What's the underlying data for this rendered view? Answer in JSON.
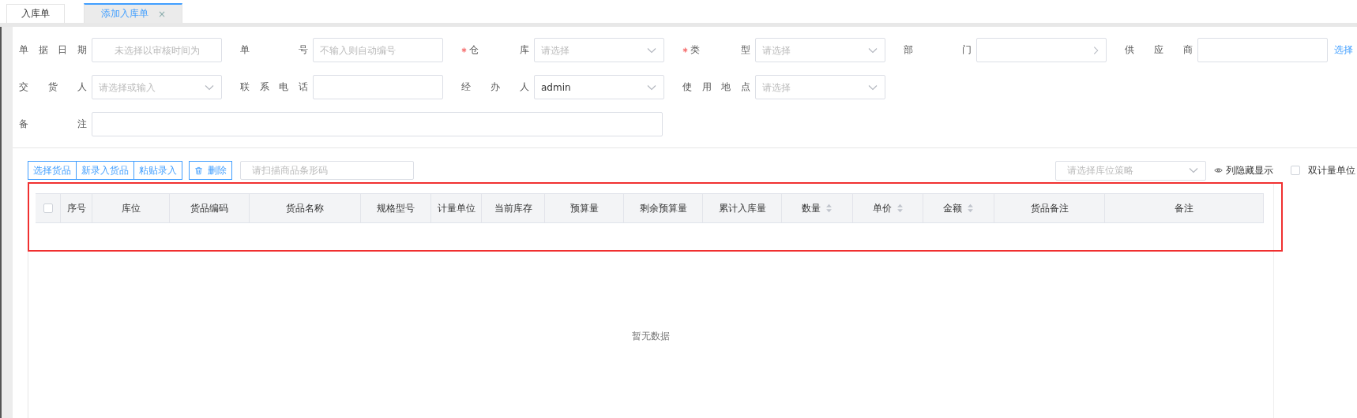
{
  "tabs": [
    {
      "label": "入库单",
      "selected": false,
      "closable": false
    },
    {
      "label": "添加入库单",
      "selected": true,
      "closable": true,
      "close": "×"
    }
  ],
  "form": {
    "rows": [
      [
        {
          "label": "单据日期",
          "kind": "date",
          "required": false,
          "placeholder": "未选择以审核时间为"
        },
        {
          "label": "单号",
          "kind": "input",
          "required": false,
          "placeholder": "不输入则自动编号"
        },
        {
          "label": "仓库",
          "kind": "select",
          "required": true,
          "placeholder": "请选择"
        },
        {
          "label": "类型",
          "kind": "select",
          "required": true,
          "placeholder": "请选择"
        },
        {
          "label": "部门",
          "kind": "cascader",
          "required": false
        },
        {
          "label": "供应商",
          "kind": "picker",
          "required": false,
          "link": "选择"
        }
      ],
      [
        {
          "label": "交货人",
          "kind": "select",
          "required": false,
          "placeholder": "请选择或输入"
        },
        {
          "label": "联系电话",
          "kind": "input",
          "required": false
        },
        {
          "label": "经办人",
          "kind": "select",
          "required": false,
          "value": "admin"
        },
        {
          "label": "使用地点",
          "kind": "select",
          "required": false,
          "placeholder": "请选择"
        }
      ],
      [
        {
          "label": "备注",
          "kind": "wide",
          "required": false
        }
      ]
    ]
  },
  "toolbar": {
    "group": [
      "选择货品",
      "新录入货品",
      "粘贴录入"
    ],
    "delete": "删除",
    "barcode_placeholder": "请扫描商品条形码",
    "strategy_placeholder": "请选择库位策略",
    "columns_toggle": "列隐藏显示",
    "dual_unit": {
      "label": "双计量单位",
      "checked": false
    }
  },
  "table": {
    "select_all": false,
    "columns": [
      {
        "label": "序号",
        "sortable": false
      },
      {
        "label": "库位",
        "sortable": false
      },
      {
        "label": "货品编码",
        "sortable": false
      },
      {
        "label": "货品名称",
        "sortable": false
      },
      {
        "label": "规格型号",
        "sortable": false
      },
      {
        "label": "计量单位",
        "sortable": false
      },
      {
        "label": "当前库存",
        "sortable": false
      },
      {
        "label": "预算量",
        "sortable": false
      },
      {
        "label": "剩余预算量",
        "sortable": false
      },
      {
        "label": "累计入库量",
        "sortable": false
      },
      {
        "label": "数量",
        "sortable": true
      },
      {
        "label": "单价",
        "sortable": true
      },
      {
        "label": "金额",
        "sortable": true
      },
      {
        "label": "货品备注",
        "sortable": false
      },
      {
        "label": "备注",
        "sortable": false
      }
    ],
    "empty_text": "暂无数据"
  }
}
